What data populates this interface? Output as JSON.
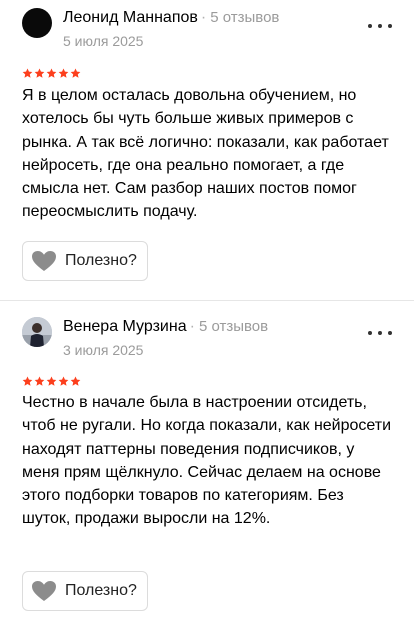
{
  "reviews": [
    {
      "author": "Леонид Маннапов",
      "reviews_count": "5 отзывов",
      "date": "5 июля 2025",
      "rating": 5,
      "text": "Я в целом осталась довольна обучением, но хотелось бы чуть больше живых примеров с рынка. А так всё логично: показали, как работает нейросеть, где она реально помогает, а где смысла нет. Сам разбор наших постов помог переосмыслить подачу.",
      "useful_label": "Полезно?"
    },
    {
      "author": "Венера Мурзина",
      "reviews_count": "5 отзывов",
      "date": "3 июля 2025",
      "rating": 5,
      "text": "Честно в начале была в настроении отсидеть, чтоб не ругали. Но когда показали, как нейросети находят паттерны поведения подписчиков, у меня прям щёлкнуло. Сейчас делаем на основе этого подборки товаров по категориям. Без шуток, продажи выросли на 12%.",
      "useful_label": "Полезно?"
    }
  ],
  "colors": {
    "star": "#fc3f1d",
    "muted_text": "#9b9b9b",
    "heart": "#8c8c8c"
  },
  "icons": {
    "more": "three-dots-icon",
    "useful": "heart-icon",
    "rating": "star-icon"
  }
}
